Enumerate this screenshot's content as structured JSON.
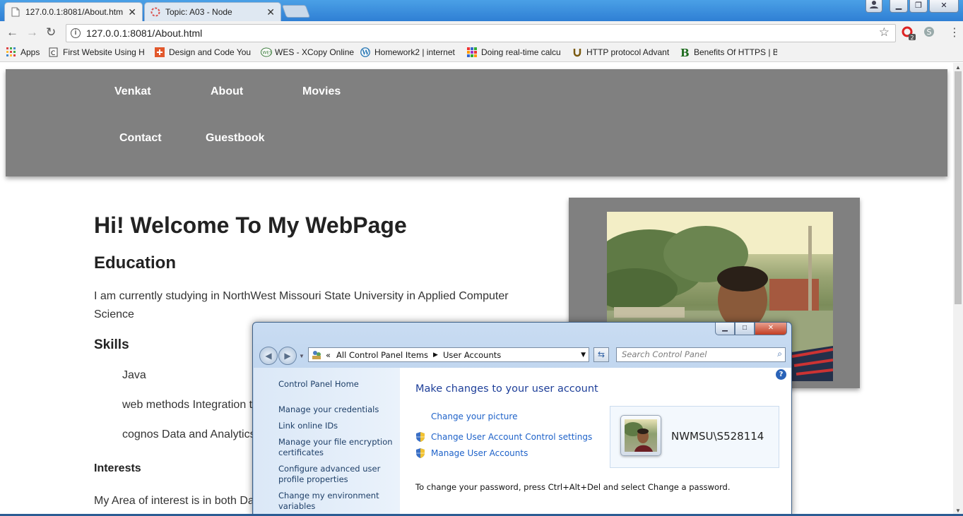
{
  "browser": {
    "tabs": [
      {
        "title": "127.0.0.1:8081/About.htm",
        "active": true
      },
      {
        "title": "Topic: A03 - Node",
        "active": false
      }
    ],
    "url_host": "127.0.0.1",
    "url_path": ":8081/About.html",
    "extension_badge": "2",
    "bookmarks": [
      {
        "label": "Apps",
        "icon": "apps-grid-icon"
      },
      {
        "label": "First Website Using H",
        "icon": "c-page-icon"
      },
      {
        "label": "Design and Code You",
        "icon": "plus-square-icon"
      },
      {
        "label": "WES - XCopy Online",
        "icon": "wes-icon"
      },
      {
        "label": "Homework2 | internet",
        "icon": "wordpress-icon"
      },
      {
        "label": "Doing real-time calcu",
        "icon": "color-grid-icon"
      },
      {
        "label": "HTTP protocol Advant",
        "icon": "horseshoe-icon"
      },
      {
        "label": "Benefits Of HTTPS | Be",
        "icon": "b-logo-icon"
      }
    ]
  },
  "site": {
    "nav": [
      "Venkat",
      "About",
      "Movies",
      "Contact",
      "Guestbook"
    ],
    "heading": "Hi! Welcome To My WebPage",
    "education_heading": "Education",
    "education_text": "I am currently studying in NorthWest Missouri State University in Applied Computer Science",
    "skills_heading": "Skills",
    "skills": [
      "Java",
      "web methods Integration t",
      "cognos Data and Analytics"
    ],
    "interests_heading": "Interests",
    "interests_text": "My Area of interest is in both Da"
  },
  "control_panel": {
    "breadcrumb_prefix": "«",
    "breadcrumb": [
      "All Control Panel Items",
      "User Accounts"
    ],
    "search_placeholder": "Search Control Panel",
    "left_links": [
      "Control Panel Home",
      "Manage your credentials",
      "Link online IDs",
      "Manage your file encryption certificates",
      "Configure advanced user profile properties",
      "Change my environment variables"
    ],
    "title": "Make changes to your user account",
    "tasks": [
      {
        "label": "Change your picture",
        "shield": false
      },
      {
        "label": "Change User Account Control settings",
        "shield": true
      },
      {
        "label": "Manage User Accounts",
        "shield": true
      }
    ],
    "username": "NWMSU\\S528114",
    "note": "To change your password, press Ctrl+Alt+Del and select Change a password."
  }
}
